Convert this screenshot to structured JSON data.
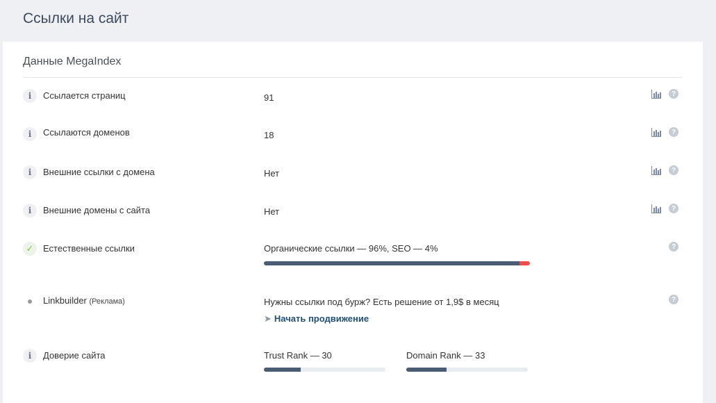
{
  "page": {
    "title": "Ссылки на сайт"
  },
  "section": {
    "title": "Данные MegaIndex"
  },
  "rows": [
    {
      "label": "Ссылается страниц",
      "value": "91",
      "icon": "info-icon"
    },
    {
      "label": "Ссылаются доменов",
      "value": "18",
      "icon": "info-icon"
    },
    {
      "label": "Внешние ссылки с домена",
      "value": "Нет",
      "icon": "info-icon"
    },
    {
      "label": "Внешние домены с сайта",
      "value": "Нет",
      "icon": "info-icon"
    }
  ],
  "natural": {
    "label": "Естественные ссылки",
    "text": "Органические ссылки — 96%, SEO — 4%",
    "organic_percent": 96,
    "seo_percent": 4,
    "icon": "checkmark-icon"
  },
  "linkbuilder": {
    "label": "Linkbuilder",
    "ad_label": "(Реклама)",
    "text": "Нужны ссылки под бурж? Есть решение от 1,9$ в месяц",
    "link_label": "Начать продвижение",
    "icon": "rocket-icon"
  },
  "trust": {
    "label": "Доверие сайта",
    "trust_rank_label": "Trust Rank — 30",
    "trust_rank": 30,
    "domain_rank_label": "Domain Rank — 33",
    "domain_rank": 33
  },
  "icons": {
    "help": "?",
    "info": "i",
    "check": "✓"
  },
  "colors": {
    "bar_fill": "#4a5d75",
    "bar_seo": "#ef4c4c",
    "link": "#1f4f75",
    "check": "#7cc243"
  }
}
